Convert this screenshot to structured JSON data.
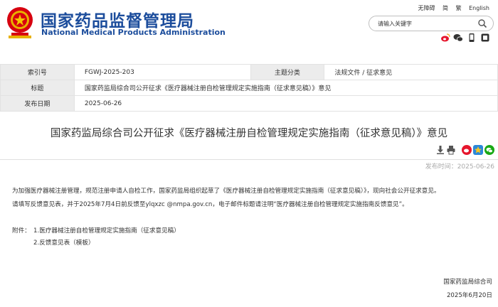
{
  "header": {
    "title_cn": "国家药品监督管理局",
    "title_en": "National Medical Products Administration",
    "links": [
      "无障碍",
      "简",
      "繁",
      "English"
    ],
    "search": {
      "placeholder": "请输入关键字"
    },
    "social_icons": [
      "weibo-icon",
      "wechat-icon",
      "mobile-icon",
      "app-icon"
    ],
    "brand_color": "#1c4d9c",
    "emblem_color": "#d7000f"
  },
  "info": {
    "index_label": "索引号",
    "index_value": "FGWJ-2025-203",
    "topic_label": "主题分类",
    "topic_value": "法规文件 / 征求意见",
    "title_label": "标题",
    "title_value": "国家药监局综合司公开征求《医疗器械注册自检管理规定实施指南（征求意见稿）》意见",
    "date_label": "发布日期",
    "date_value": "2025-06-26"
  },
  "article": {
    "title": "国家药监局综合司公开征求《医疗器械注册自检管理规定实施指南（征求意见稿）》意见",
    "tools": [
      "download-icon",
      "print-icon",
      "weibo-share-icon",
      "qzone-share-icon",
      "wechat-share-icon"
    ],
    "pubdate": "发布时间：2025-06-26",
    "p1": "为加强医疗器械注册管理，规范注册申请人自检工作，国家药监局组织起草了《医疗器械注册自检管理规定实施指南（征求意见稿）》，现向社会公开征求意见。",
    "p2": "请填写反馈意见表，并于2025年7月4日前反馈至ylqxzc @nmpa.gov.cn，电子邮件标题请注明“医疗器械注册自检管理规定实施指南反馈意见”。",
    "attachments_label": "附件：",
    "attachments": [
      "1.医疗器械注册自检管理规定实施指南（征求意见稿）",
      "2.反馈意见表（模板）"
    ],
    "sign_org": "国家药监局综合司",
    "sign_date": "2025年6月20日"
  }
}
